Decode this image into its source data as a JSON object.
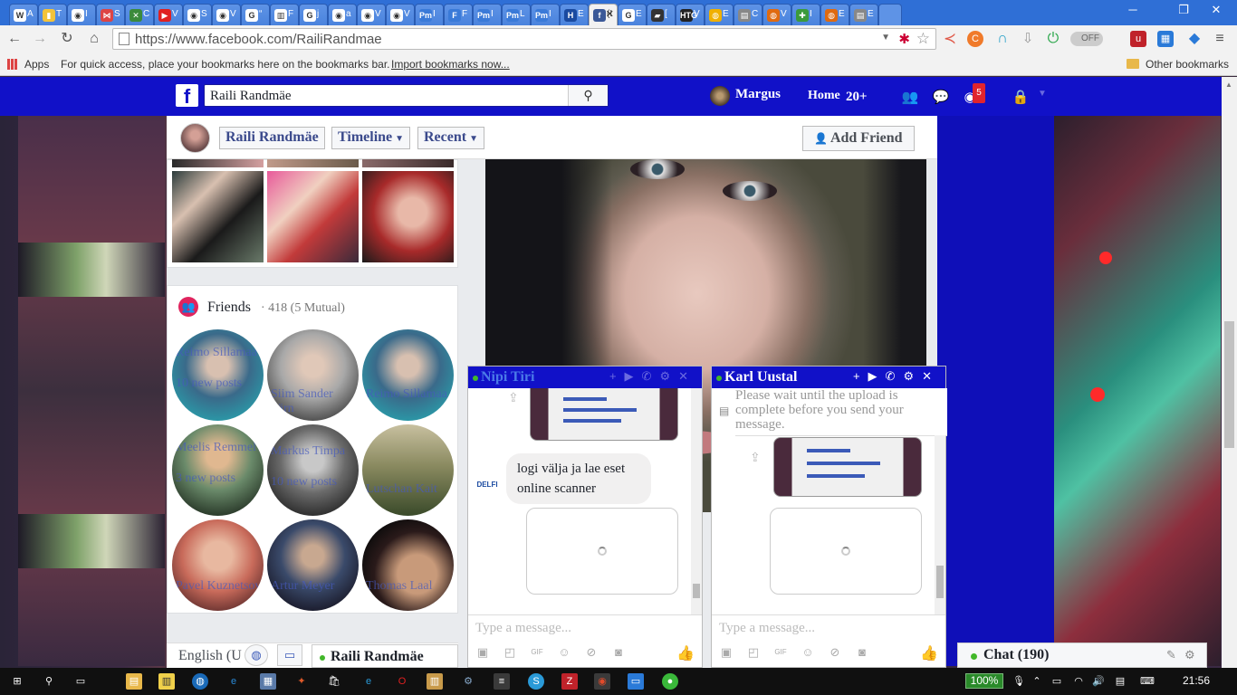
{
  "browser": {
    "url": "https://www.facebook.com/RailiRandmae",
    "tabs": [
      {
        "fav": "W",
        "label": "A",
        "color": "#ffffff"
      },
      {
        "fav": "▮",
        "label": "T",
        "color": "#f3c33a"
      },
      {
        "fav": "◉",
        "label": "I",
        "color": "#ffffff"
      },
      {
        "fav": "⋈",
        "label": "S",
        "color": "#d44"
      },
      {
        "fav": "✕",
        "label": "C",
        "color": "#3b8a3b"
      },
      {
        "fav": "▶",
        "label": "V",
        "color": "#e02020"
      },
      {
        "fav": "◉",
        "label": "S",
        "color": "#ffffff"
      },
      {
        "fav": "◉",
        "label": "V",
        "color": "#ffffff"
      },
      {
        "fav": "G",
        "label": "“",
        "color": "#ffffff"
      },
      {
        "fav": "▥",
        "label": "F",
        "color": "#ffffff"
      },
      {
        "fav": "G",
        "label": "j",
        "color": "#ffffff"
      },
      {
        "fav": "◉",
        "label": "a",
        "color": "#ffffff"
      },
      {
        "fav": "◉",
        "label": "V",
        "color": "#ffffff"
      },
      {
        "fav": "◉",
        "label": "V",
        "color": "#ffffff"
      },
      {
        "fav": "Pm",
        "label": "I",
        "color": "#3a7ad8"
      },
      {
        "fav": "F",
        "label": "F",
        "color": "#3a7ad8"
      },
      {
        "fav": "Pm",
        "label": "I",
        "color": "#3a7ad8"
      },
      {
        "fav": "Pm",
        "label": "L",
        "color": "#3a7ad8"
      },
      {
        "fav": "Pm",
        "label": "I",
        "color": "#3a7ad8"
      },
      {
        "fav": "H",
        "label": "E",
        "color": "#1a4aa0"
      },
      {
        "fav": "f",
        "label": "(!",
        "color": "#3b5998",
        "active": true
      },
      {
        "fav": "G",
        "label": "E",
        "color": "#ffffff"
      },
      {
        "fav": "▰",
        "label": "[",
        "color": "#333333"
      },
      {
        "fav": "HTG",
        "label": "V",
        "color": "#222222"
      },
      {
        "fav": "◍",
        "label": "E",
        "color": "#f0b000"
      },
      {
        "fav": "▤",
        "label": "C",
        "color": "#888888"
      },
      {
        "fav": "◍",
        "label": "V",
        "color": "#e06a10"
      },
      {
        "fav": "✚",
        "label": "I",
        "color": "#3b9a3b"
      },
      {
        "fav": "◍",
        "label": "E",
        "color": "#e06a10"
      },
      {
        "fav": "▤",
        "label": "E",
        "color": "#888888"
      }
    ],
    "bookmarks": {
      "apps": "Apps",
      "hint": "For quick access, place your bookmarks here on the bookmarks bar.",
      "import": "Import bookmarks now...",
      "other": "Other bookmarks"
    },
    "toggle_label": "OFF"
  },
  "fb": {
    "search_value": "Raili Randmäe",
    "user_name": "Margus",
    "home_label": "Home",
    "home_count": "20+",
    "notif_count": "5",
    "profile": {
      "name": "Raili Randmäe",
      "timeline_label": "Timeline",
      "recent_label": "Recent",
      "add_friend_label": "Add Friend"
    },
    "friends": {
      "title": "Friends",
      "count": "· 418 (5 Mutual)",
      "items": [
        {
          "name": "Reimo Sillamaa",
          "sub": "10 new posts"
        },
        {
          "name": "Siim Sander Pärn",
          "sub": ""
        },
        {
          "name": "Reimo Sillamaa",
          "sub": ""
        },
        {
          "name": "Meelis Remmel",
          "sub": "3 new posts"
        },
        {
          "name": "Markus Timpa",
          "sub": "10 new posts"
        },
        {
          "name": "Lutschan Kait",
          "sub": ""
        },
        {
          "name": "Pavel Kuznetsov",
          "sub": ""
        },
        {
          "name": "Artur Meyer",
          "sub": ""
        },
        {
          "name": "Thomas Laal",
          "sub": ""
        }
      ]
    },
    "language": "English (U",
    "mini_chat_name": "Raili Randmäe",
    "chat_sidebar_label": "Chat (190)"
  },
  "chat1": {
    "name": "Nipi Tiri",
    "message": "logi välja ja lae eset online scanner",
    "sender_logo": "DELFI",
    "placeholder": "Type a message..."
  },
  "chat2": {
    "name": "Karl Uustal",
    "upload_notice": "Please wait until the upload is complete before you send your message.",
    "placeholder": "Type a message..."
  },
  "taskbar": {
    "battery": "100%",
    "clock": "21:56"
  },
  "colors": {
    "fb_blue": "#1111c8",
    "chrome_blue": "#2f6fd6",
    "online_green": "#42b72a"
  }
}
